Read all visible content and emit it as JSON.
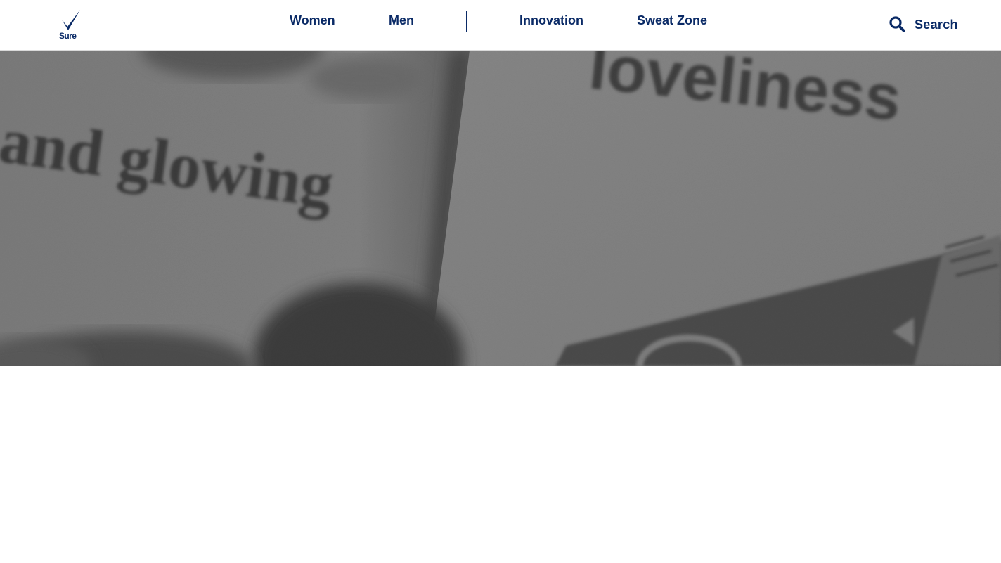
{
  "brand": {
    "logo_text": "Sure",
    "color": "#0a2a66"
  },
  "nav": {
    "items": [
      {
        "label": "Women"
      },
      {
        "label": "Men"
      },
      {
        "label": "Innovation"
      },
      {
        "label": "Sweat Zone"
      }
    ]
  },
  "search": {
    "label": "Search",
    "icon": "search-icon"
  },
  "hero": {
    "image_text_left": "and glowing",
    "image_text_right": "loveliness",
    "tone": "#7a7a7a"
  }
}
